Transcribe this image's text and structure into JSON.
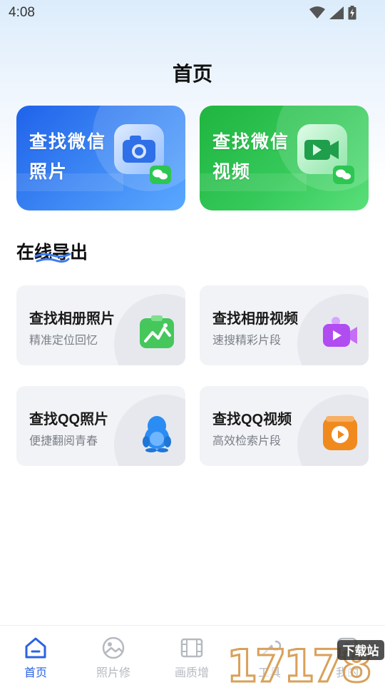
{
  "status_bar": {
    "time": "4:08"
  },
  "header": {
    "title": "首页"
  },
  "hero_cards": [
    {
      "line1": "查找微信",
      "line2": "照片",
      "icon": "camera-icon"
    },
    {
      "line1": "查找微信",
      "line2": "视频",
      "icon": "video-icon"
    }
  ],
  "section": {
    "title": "在线导出"
  },
  "func_cards": [
    {
      "title": "查找相册照片",
      "subtitle": "精准定位回忆",
      "icon": "gallery-icon",
      "color": "#45c75c"
    },
    {
      "title": "查找相册视频",
      "subtitle": "速搜精彩片段",
      "icon": "video-camera-icon",
      "color": "#b04cf0"
    },
    {
      "title": "查找QQ照片",
      "subtitle": "便捷翻阅青春",
      "icon": "qq-penguin-icon",
      "color": "#2b8cf3"
    },
    {
      "title": "查找QQ视频",
      "subtitle": "高效检索片段",
      "icon": "play-icon",
      "color": "#f08a1e"
    }
  ],
  "bottom_nav": [
    {
      "label": "首页",
      "active": true,
      "icon": "home-icon"
    },
    {
      "label": "照片修",
      "active": false,
      "icon": "photo-repair-icon"
    },
    {
      "label": "画质增",
      "active": false,
      "icon": "film-icon"
    },
    {
      "label": "工具",
      "active": false,
      "icon": "tools-icon"
    },
    {
      "label": "我的",
      "active": false,
      "icon": "profile-icon"
    }
  ],
  "watermark": {
    "brand": "17178",
    "tag": "下载站"
  },
  "colors": {
    "accent": "#2a62e5",
    "photo_card": "#2f75ee",
    "video_card": "#2cbf4e"
  }
}
